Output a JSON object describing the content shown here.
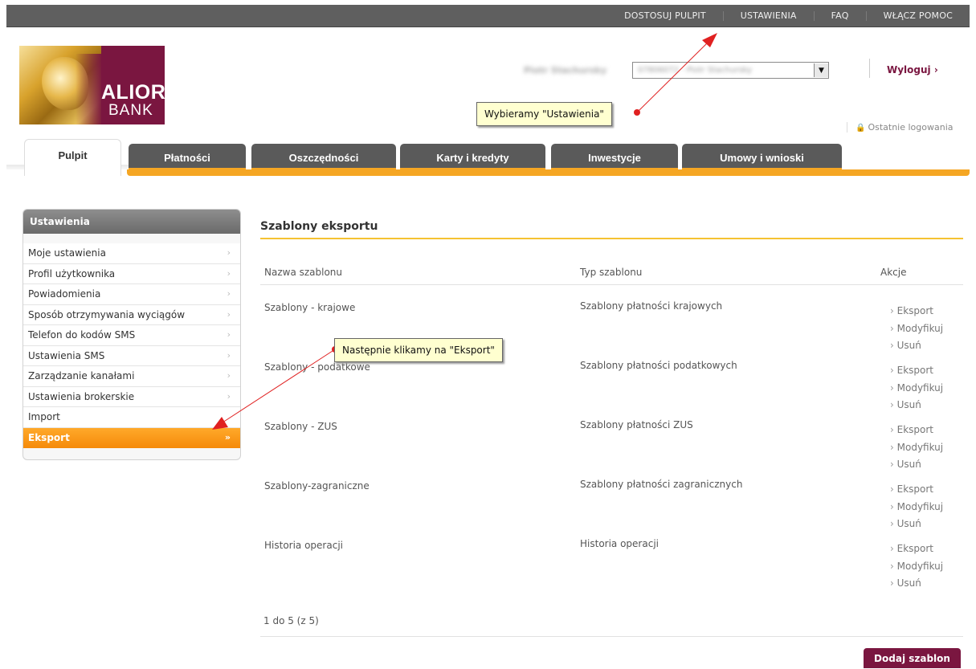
{
  "topnav": [
    "DOSTOSUJ PULPIT",
    "USTAWIENIA",
    "FAQ",
    "WŁĄCZ POMOC"
  ],
  "logo": {
    "line1": "ALIOR",
    "line2": "BANK"
  },
  "user": {
    "name": "Piotr Stachursky",
    "account": "07806072 - Piotr Stachursky"
  },
  "logout": "Wyloguj ›",
  "last_login": "Ostatnie logowania",
  "callouts": {
    "settings": "Wybieramy \"Ustawienia\"",
    "export": "Następnie klikamy na \"Eksport\""
  },
  "tabs": [
    "Pulpit",
    "Płatności",
    "Oszczędności",
    "Karty i kredyty",
    "Inwestycje",
    "Umowy i wnioski"
  ],
  "sidebar": {
    "title": "Ustawienia",
    "items": [
      "Moje ustawienia",
      "Profil użytkownika",
      "Powiadomienia",
      "Sposób otrzymywania wyciągów",
      "Telefon do kodów SMS",
      "Ustawienia SMS",
      "Zarządzanie kanałami",
      "Ustawienia brokerskie",
      "Import",
      "Eksport"
    ],
    "active": "Eksport"
  },
  "main": {
    "title": "Szablony eksportu",
    "columns": [
      "Nazwa szablonu",
      "Typ szablonu",
      "Akcje"
    ],
    "rows": [
      {
        "name": "Szablony - krajowe",
        "type": "Szablony płatności krajowych"
      },
      {
        "name": "Szablony - podatkowe",
        "type": "Szablony płatności podatkowych"
      },
      {
        "name": "Szablony - ZUS",
        "type": "Szablony płatności ZUS"
      },
      {
        "name": "Szablony-zagraniczne",
        "type": "Szablony płatności zagranicznych"
      },
      {
        "name": "Historia operacji",
        "type": "Historia operacji"
      }
    ],
    "actions": [
      "Eksport",
      "Modyfikuj",
      "Usuń"
    ],
    "pager": "1 do 5 (z 5)",
    "add_button": "Dodaj szablon"
  },
  "colors": {
    "brand": "#7a1640",
    "accent": "#f5a623",
    "topbar": "#5f5f5f"
  }
}
